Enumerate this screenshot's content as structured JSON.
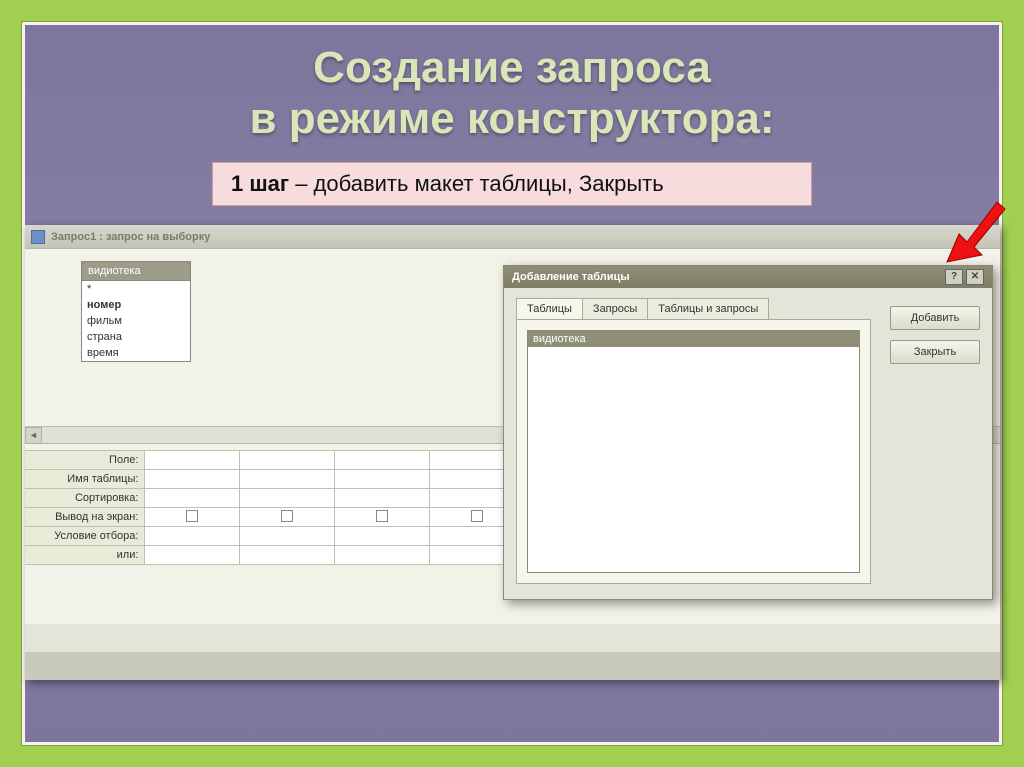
{
  "slide": {
    "title_line1": "Создание запроса",
    "title_line2": "в режиме конструктора:",
    "instruction_bold": "1 шаг",
    "instruction_rest": " – добавить макет таблицы, Закрыть"
  },
  "appWindow": {
    "title": "Запрос1 : запрос на выборку"
  },
  "tableBox": {
    "header": "видиотека",
    "fields": [
      "*",
      "номер",
      "фильм",
      "страна",
      "время"
    ]
  },
  "gridRows": {
    "r1": "Поле:",
    "r2": "Имя таблицы:",
    "r3": "Сортировка:",
    "r4": "Вывод на экран:",
    "r5": "Условие отбора:",
    "r6": "или:"
  },
  "dialog": {
    "title": "Добавление таблицы",
    "tabs": [
      "Таблицы",
      "Запросы",
      "Таблицы и запросы"
    ],
    "listSelected": "видиотека",
    "btnAdd": "Добавить",
    "btnClose": "Закрыть"
  }
}
